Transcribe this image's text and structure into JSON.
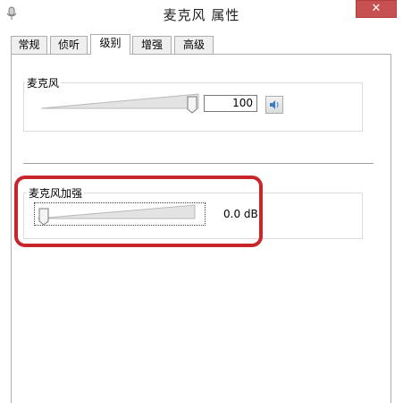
{
  "window": {
    "title": "麦克风 属性",
    "close_glyph": "✕"
  },
  "tabs": [
    {
      "label": "常规",
      "active": false
    },
    {
      "label": "侦听",
      "active": false
    },
    {
      "label": "级别",
      "active": true
    },
    {
      "label": "增强",
      "active": false
    },
    {
      "label": "高级",
      "active": false
    }
  ],
  "microphone": {
    "label": "麦克风",
    "level_value": "100",
    "level_fraction": 1.0,
    "speaker_icon": "speaker-icon"
  },
  "boost": {
    "label": "麦克风加强",
    "value_text": "0.0 dB",
    "level_fraction": 0.0
  },
  "colors": {
    "highlight": "#c8262b",
    "close_button": "#c75050"
  }
}
